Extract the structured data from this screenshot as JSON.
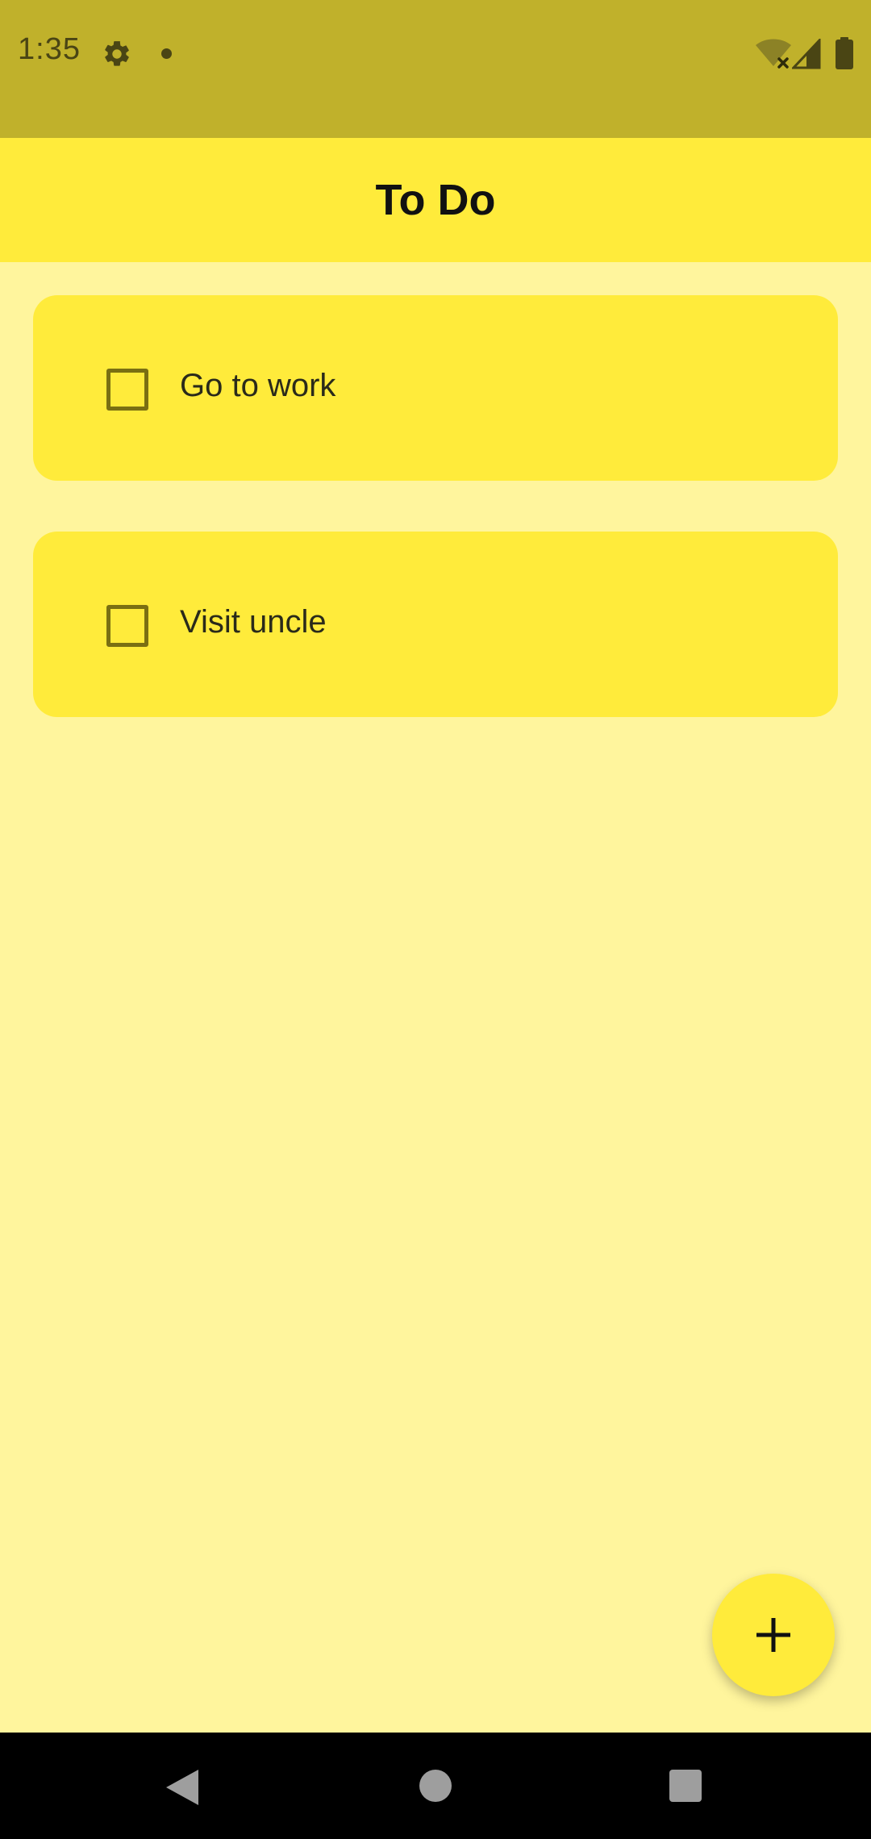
{
  "status_bar": {
    "time": "1:35",
    "icons": [
      "gear-icon",
      "notification-dot-icon",
      "wifi-off-icon",
      "cell-signal-icon",
      "battery-icon"
    ],
    "background": "#C0B12B"
  },
  "app_bar": {
    "title": "To Do",
    "background": "#FFEB3B"
  },
  "todos": [
    {
      "label": "Go to work",
      "checked": false
    },
    {
      "label": "Visit uncle",
      "checked": false
    }
  ],
  "fab": {
    "icon": "plus-icon",
    "background": "#FFEB3B"
  },
  "nav_bar": {
    "icons": [
      "back-icon",
      "home-icon",
      "recents-icon"
    ]
  },
  "colors": {
    "page_background": "#FFF59D",
    "card_background": "#FFEB3B",
    "checkbox_border": "#7A6F12"
  }
}
